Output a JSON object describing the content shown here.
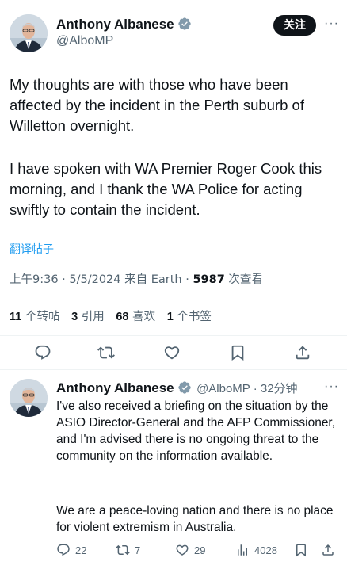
{
  "main_tweet": {
    "author_name": "Anthony Albanese",
    "handle": "@AlboMP",
    "follow_label": "关注",
    "more_label": "···",
    "paragraph1": "My thoughts are with those who have been affected by the incident in the Perth suburb of Willetton overnight.",
    "paragraph2": "I have spoken with WA Premier Roger Cook this morning, and I thank the WA Police for acting swiftly to contain the incident.",
    "translate_label": "翻译帖子",
    "timestamp": "上午9:36 · 5/5/2024 来自 Earth · ",
    "views_count": "5987",
    "views_label": " 次查看"
  },
  "stats": [
    {
      "count": "11",
      "label": "个转帖"
    },
    {
      "count": "3",
      "label": "引用"
    },
    {
      "count": "68",
      "label": "喜欢"
    },
    {
      "count": "1",
      "label": "个书签"
    }
  ],
  "actions": {
    "icons": [
      "reply-icon",
      "retweet-icon",
      "like-icon",
      "bookmark-icon",
      "share-icon"
    ]
  },
  "reply": {
    "author_name": "Anthony Albanese",
    "handle_time": "@AlboMP · 32分钟",
    "more_label": "···",
    "paragraph1": "I've also received a briefing on the situation by the ASIO Director-General and the AFP Commissioner, and I'm advised there is no ongoing threat to the community on the information available.",
    "paragraph2": "We are a peace-loving nation and there is no place for violent extremism in Australia.",
    "reply_count": "22",
    "retweet_count": "7",
    "like_count": "29",
    "view_count": "4028"
  },
  "colors": {
    "text": "#0f1419",
    "secondary": "#536471",
    "link": "#1d9bf0",
    "verified": "#829aab",
    "divider": "#eff3f4"
  }
}
